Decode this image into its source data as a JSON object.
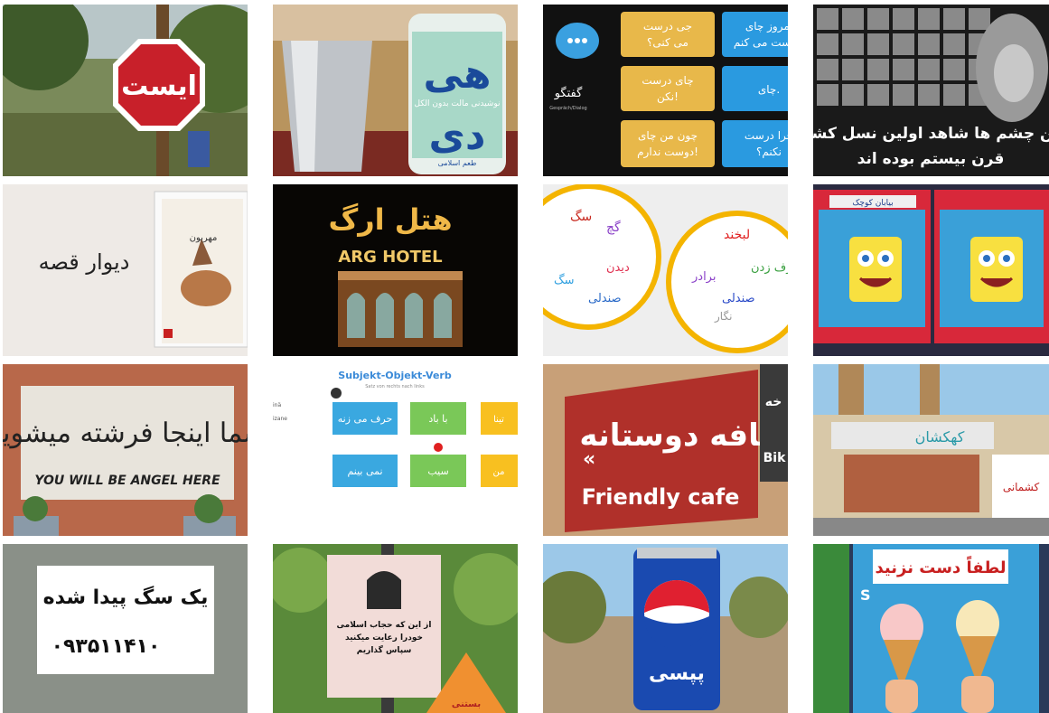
{
  "gallery": {
    "tiles": [
      {
        "id": "stop-sign",
        "text": [
          "ایست"
        ]
      },
      {
        "id": "cup-and-can",
        "text": [
          "هی",
          "دی",
          "نوشیدنی مالت بدون الکل",
          "طعم اسلامی"
        ]
      },
      {
        "id": "dialog-chart",
        "text": [
          "جی درست",
          "می کنی؟",
          "چای درست",
          "نکن!",
          "چون من چای",
          "دوست ندارم!",
          "گفتگو",
          "Gespräch/Dialog",
          "امروز چای",
          "درست می کنم.",
          "چای.",
          "چرا درست",
          "نکنم؟"
        ]
      },
      {
        "id": "portrait-banner",
        "text": [
          "این چشم ها شاهد اولین نسل کشی",
          "قرن بیستم بوده اند"
        ]
      },
      {
        "id": "story-wall",
        "text": [
          "دیوار قصه",
          "مهربون"
        ]
      },
      {
        "id": "arg-hotel",
        "text": [
          "هتل ارگ",
          "ARG HOTEL"
        ]
      },
      {
        "id": "word-circles",
        "text": [
          "سگ",
          "گچ",
          "حرف زدن",
          "برادر",
          "نگار",
          "صندلی",
          "لبخند",
          "سگ",
          "ديدن"
        ]
      },
      {
        "id": "cartoon-billboard",
        "text": [
          "بیابان کوچک"
        ]
      },
      {
        "id": "angel-sign",
        "text": [
          "شما اینجا فرشته میشوید",
          "YOU WILL BE ANGEL HERE"
        ]
      },
      {
        "id": "svo-slide",
        "text": [
          "Subjekt-Objekt-Verb",
          "Satz von rechts nach links",
          "حرف می زنه",
          "با باد",
          "نمی بینم",
          "سیب",
          "من",
          "تینا",
          "inä",
          "izane"
        ]
      },
      {
        "id": "friendly-cafe",
        "text": [
          "کافه دوستانه",
          "Friendly cafe",
          "خه",
          "Bik"
        ]
      },
      {
        "id": "shop-street",
        "text": [
          "کشمانی",
          "کهکشان"
        ]
      },
      {
        "id": "lost-dog",
        "text": [
          "یک سگ پیدا شده",
          "۰۹۳۵۱۱۴۱۰"
        ]
      },
      {
        "id": "hijab-note",
        "text": [
          "از این که حجاب اسلامی",
          "خودرا رعایت میکنید",
          "سپاس گذاریم",
          "بستنی"
        ]
      },
      {
        "id": "pepsi-can",
        "text": [
          "پپسی"
        ]
      },
      {
        "id": "ice-cream-sign",
        "text": [
          "لطفاً دست نزنید",
          "S"
        ]
      }
    ]
  }
}
